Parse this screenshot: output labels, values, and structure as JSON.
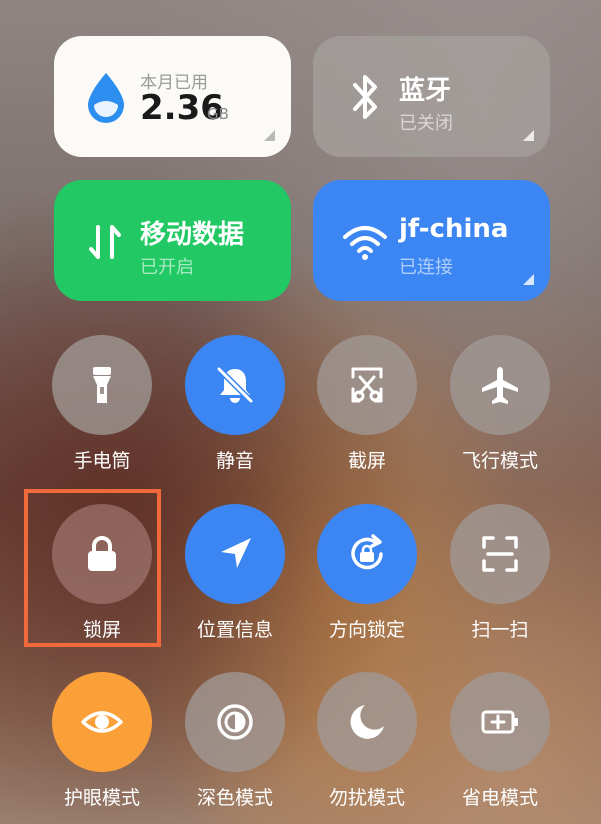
{
  "tiles": {
    "data_usage": {
      "label": "本月已用",
      "value": "2.36",
      "unit": "GB"
    },
    "bluetooth": {
      "title": "蓝牙",
      "status": "已关闭",
      "icon": "bluetooth-icon"
    },
    "mobile_data": {
      "title": "移动数据",
      "status": "已开启",
      "icon": "mobile-data-arrows-icon"
    },
    "wifi": {
      "title": "jf-china",
      "status": "已连接",
      "icon": "wifi-icon"
    }
  },
  "toggles": [
    {
      "label": "手电筒",
      "icon": "flashlight-icon",
      "state": "off"
    },
    {
      "label": "静音",
      "icon": "bell-muted-icon",
      "state": "on"
    },
    {
      "label": "截屏",
      "icon": "screenshot-icon",
      "state": "off"
    },
    {
      "label": "飞行模式",
      "icon": "airplane-icon",
      "state": "off"
    },
    {
      "label": "锁屏",
      "icon": "lock-icon",
      "state": "off",
      "highlighted": true
    },
    {
      "label": "位置信息",
      "icon": "location-icon",
      "state": "on"
    },
    {
      "label": "方向锁定",
      "icon": "rotation-lock-icon",
      "state": "on"
    },
    {
      "label": "扫一扫",
      "icon": "scan-icon",
      "state": "off"
    },
    {
      "label": "护眼模式",
      "icon": "eye-icon",
      "state": "on"
    },
    {
      "label": "深色模式",
      "icon": "dark-mode-icon",
      "state": "off"
    },
    {
      "label": "勿扰模式",
      "icon": "moon-icon",
      "state": "off"
    },
    {
      "label": "省电模式",
      "icon": "battery-saver-icon",
      "state": "off"
    }
  ],
  "colors": {
    "blue": "#3b86f3",
    "green": "#21c864",
    "orange": "#fba039",
    "highlight_border": "#f06a3c"
  }
}
